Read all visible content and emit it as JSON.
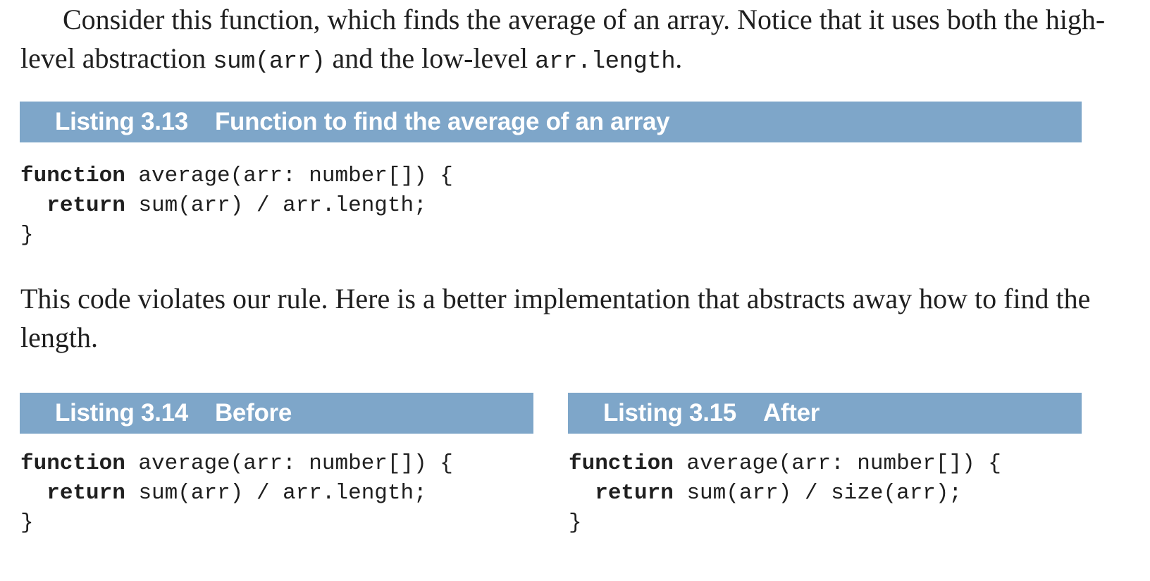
{
  "paragraph1": {
    "t1": "Consider this function, which finds the average of an array. Notice that it uses both the high-level abstraction ",
    "c1": "sum(arr)",
    "t2": " and the low-level ",
    "c2": "arr.length",
    "t3": "."
  },
  "listing_3_13": {
    "number": "Listing 3.13",
    "caption": "Function to find the average of an array",
    "line1_kw": "function",
    "line1_rest": " average(arr: number[]) {",
    "line2_kw": "return",
    "line2_rest": " sum(arr) / arr.length;",
    "line3": "}"
  },
  "paragraph2": {
    "text": "This code violates our rule. Here is a better implementation that abstracts away how to find the length."
  },
  "listing_3_14": {
    "number": "Listing 3.14",
    "caption": "Before",
    "line1_kw": "function",
    "line1_rest": " average(arr: number[]) {",
    "line2_kw": "return",
    "line2_rest": " sum(arr) / arr.length;",
    "line3": "}"
  },
  "listing_3_15": {
    "number": "Listing 3.15",
    "caption": "After",
    "line1_kw": "function",
    "line1_rest": " average(arr: number[]) {",
    "line2_kw": "return",
    "line2_rest": " sum(arr) / size(arr);",
    "line3": "}"
  },
  "colors": {
    "listing_bar": "#7ea6c9",
    "listing_text": "#ffffff",
    "body_text": "#1f1f1f"
  }
}
